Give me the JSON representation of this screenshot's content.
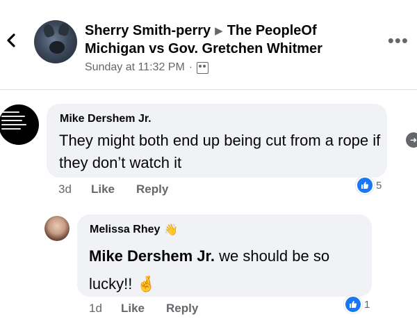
{
  "header": {
    "author": "Sherry Smith-perry",
    "arrow": "▶",
    "group_line1": "The PeopleOf",
    "group_line2": "Michigan vs Gov. Gretchen Whitmer",
    "timestamp": "Sunday at 11:32 PM",
    "separator": "·",
    "audience_icon": "group-audience-icon",
    "more_label": "•••"
  },
  "comments": [
    {
      "author": "Mike Dershem Jr.",
      "text": "They might both end up being cut from a rope if they don’t watch it",
      "time": "3d",
      "like_label": "Like",
      "reply_label": "Reply",
      "reaction_count": "5"
    },
    {
      "author": "Melissa Rhey",
      "badge": "👋",
      "mention": "Mike Dershem Jr.",
      "text": " we should be so lucky!! 🤞",
      "time": "1d",
      "like_label": "Like",
      "reply_label": "Reply",
      "reaction_count": "1"
    }
  ],
  "colors": {
    "accent": "#1877f2",
    "bubble": "#f0f2f5",
    "muted": "#65676b"
  }
}
